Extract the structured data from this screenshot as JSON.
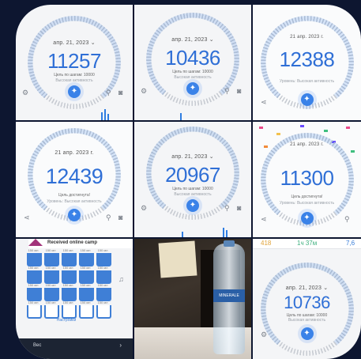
{
  "tiles": [
    {
      "date": "апр. 21, 2023 ⌄",
      "steps": "11257",
      "goal": "Цель по шагам: 10000",
      "level": "Высокая активность"
    },
    {
      "date": "апр. 21, 2023 ⌄",
      "steps": "10436",
      "goal": "Цель по шагам: 10000",
      "level": "Высокая активность"
    },
    {
      "date": "21 апр. 2023 г.",
      "steps": "12388",
      "goal": "",
      "level": "Уровень: Высокая активность"
    },
    {
      "date": "21 апр. 2023 г.",
      "steps": "12439",
      "goal": "Цель достигнута!",
      "level": "Уровень: Высокая активность"
    },
    {
      "date": "апр. 21, 2023 ⌄",
      "steps": "20967",
      "goal": "Цель по шагам: 10000",
      "level": "Высокая активность"
    },
    {
      "date": "21 апр. 2023 г.",
      "steps": "11300",
      "goal": "Цель достигнута!",
      "level": "Уровень: Высокая активность"
    },
    {
      "date": "апр. 21, 2023 ⌄",
      "steps": "10736",
      "goal": "Цель по шагам: 10000",
      "level": "Высокая активность"
    }
  ],
  "water": {
    "header": "Received online camp",
    "cup_label": "150 мл",
    "settings": "Настройки",
    "weight_label": "Вес"
  },
  "photo_label": "MINERALE",
  "stats_strip": {
    "a": "418",
    "b": "1ч 37м",
    "c": "7,6"
  },
  "icons": {
    "runner": "runner-icon",
    "search": "search-icon",
    "camera": "camera-icon"
  },
  "colors": {
    "accent": "#2f7de1",
    "background": "#0d1630"
  }
}
